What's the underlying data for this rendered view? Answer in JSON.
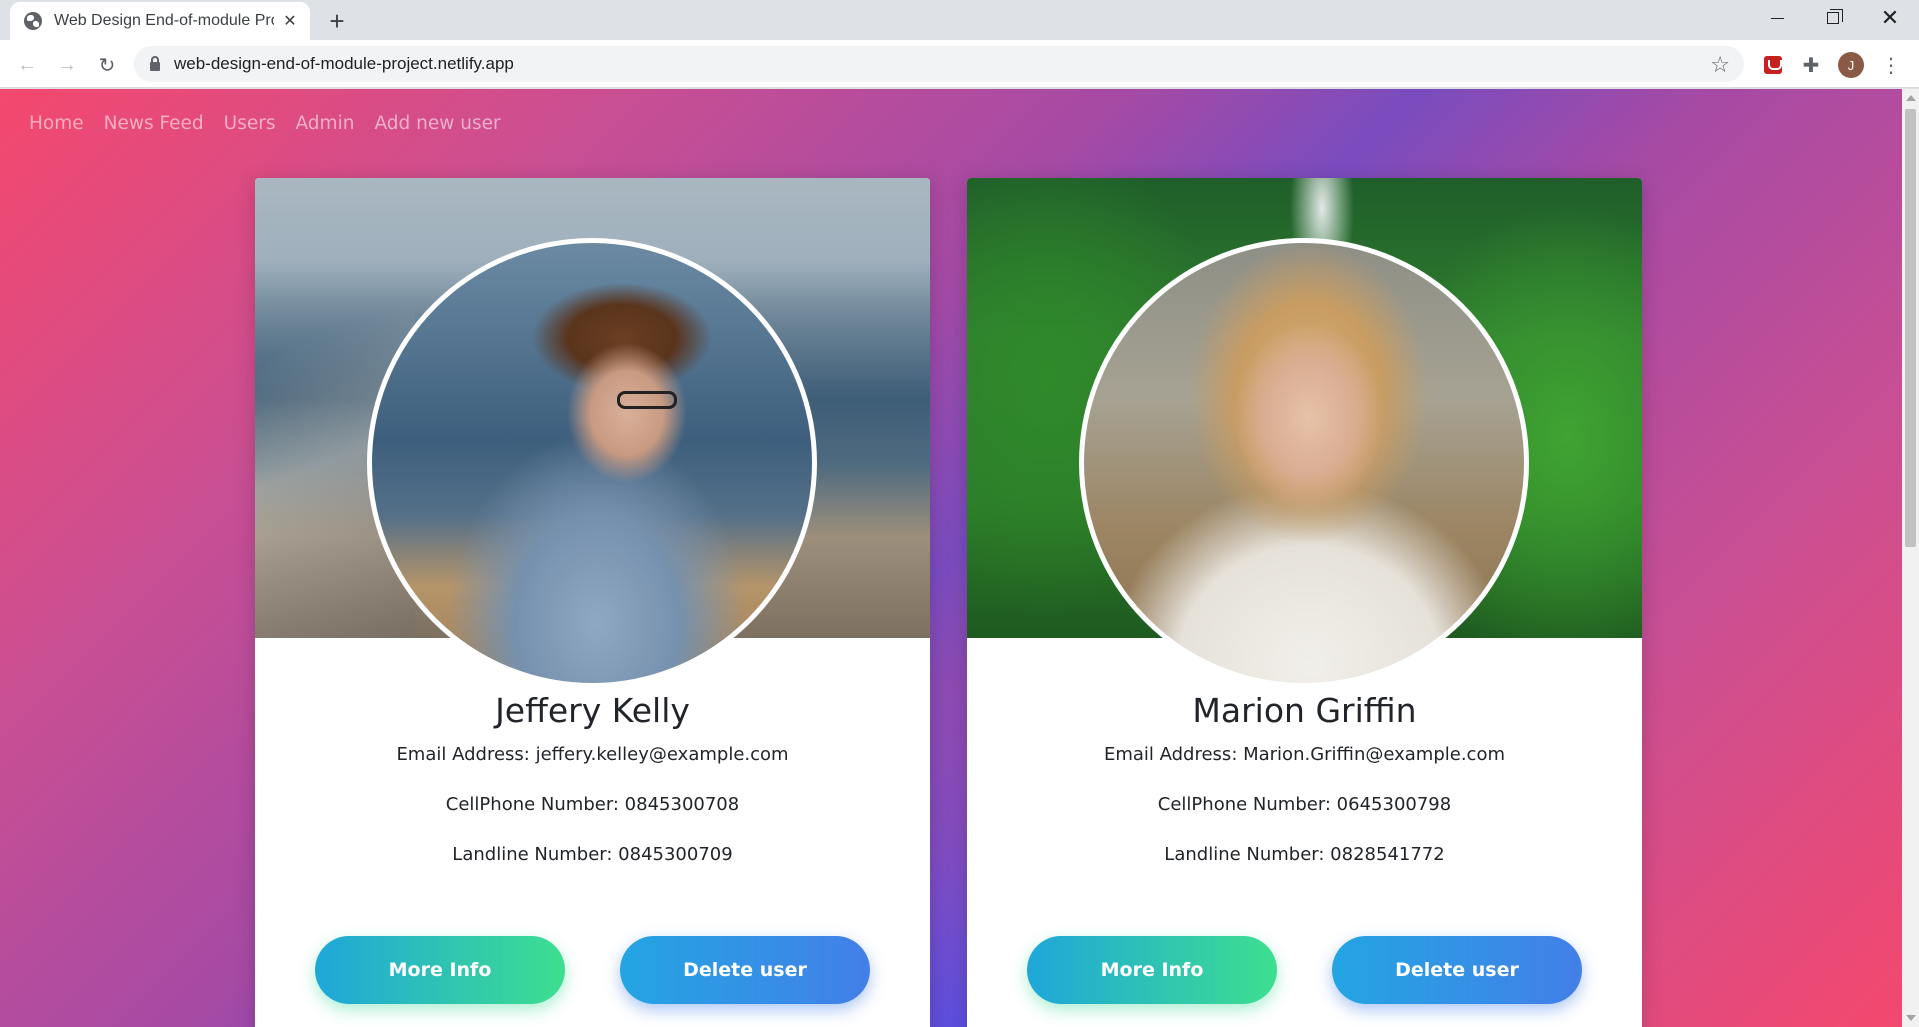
{
  "browser": {
    "tab_title": "Web Design End-of-module Proj",
    "url": "web-design-end-of-module-project.netlify.app",
    "profile_initial": "J"
  },
  "icons": {
    "favicon": "globe-icon",
    "close": "close-icon",
    "new_tab": "plus-icon",
    "back": "back-arrow-icon",
    "forward": "forward-arrow-icon",
    "reload": "reload-icon",
    "lock": "lock-icon",
    "bookmark": "star-icon",
    "extension_red": "shield-extension-icon",
    "extensions": "puzzle-icon",
    "menu": "kebab-menu-icon"
  },
  "site_nav": [
    "Home",
    "News Feed",
    "Users",
    "Admin",
    "Add new user"
  ],
  "users": [
    {
      "name": "Jeffery Kelly",
      "email_line": "Email Address: jeffery.kelley@example.com",
      "cell_line": "CellPhone Number: 0845300708",
      "landline_line": "Landline Number: 0845300709",
      "more_label": "More Info",
      "delete_label": "Delete user"
    },
    {
      "name": "Marion Griffin",
      "email_line": "Email Address: Marion.Griffin@example.com",
      "cell_line": "CellPhone Number: 0645300798",
      "landline_line": "Landline Number: 0828541772",
      "more_label": "More Info",
      "delete_label": "Delete user"
    }
  ],
  "colors": {
    "bg_pink": "#f4486e",
    "bg_purple": "#a54aa5",
    "bg_blue": "#4650f0",
    "btn_more_start": "#1fa6d9",
    "btn_more_end": "#3ddf8f",
    "btn_delete_start": "#23a5e3",
    "btn_delete_end": "#437fe8"
  }
}
